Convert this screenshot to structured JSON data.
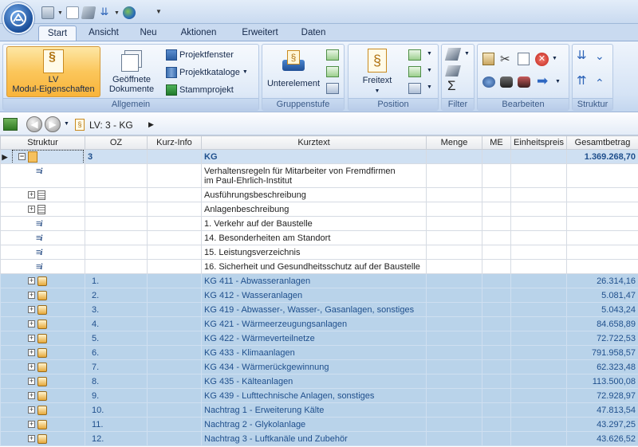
{
  "tabs": [
    "Start",
    "Ansicht",
    "Neu",
    "Aktionen",
    "Erweitert",
    "Daten"
  ],
  "ribbon": {
    "allgemein": {
      "label": "Allgemein",
      "lv_btn_line1": "LV",
      "lv_btn_line2": "Modul-Eigenschaften",
      "docs_line1": "Geöffnete",
      "docs_line2": "Dokumente",
      "projektfenster": "Projektfenster",
      "projektkataloge": "Projektkataloge",
      "stammprojekt": "Stammprojekt"
    },
    "gruppenstufe": {
      "label": "Gruppenstufe",
      "unterelement": "Unterelement"
    },
    "position": {
      "label": "Position",
      "freitext": "Freitext"
    },
    "filter": {
      "label": "Filter"
    },
    "bearbeiten": {
      "label": "Bearbeiten"
    },
    "struktur": {
      "label": "Struktur"
    }
  },
  "nav": {
    "breadcrumb": "LV: 3 - KG",
    "arrow": "▶"
  },
  "grid": {
    "columns": [
      "Struktur",
      "OZ",
      "Kurz-Info",
      "Kurztext",
      "Menge",
      "ME",
      "Einheitspreis",
      "Gesamtbetrag"
    ],
    "first_row": {
      "oz": "3",
      "kurztext": "KG",
      "gesamt": "1.369.268,70"
    },
    "text_rows": [
      {
        "kind": "i",
        "line1": "Verhaltensregeln für Mitarbeiter von Fremdfirmen",
        "line2": "im Paul-Ehrlich-Institut"
      },
      {
        "kind": "doc",
        "line1": "Ausführungsbeschreibung"
      },
      {
        "kind": "doc",
        "line1": "Anlagenbeschreibung"
      },
      {
        "kind": "i",
        "line1": "1.  Verkehr auf der Baustelle"
      },
      {
        "kind": "i",
        "line1": "14.  Besonderheiten am Standort"
      },
      {
        "kind": "i",
        "line1": "15. Leistungsverzeichnis"
      },
      {
        "kind": "i",
        "line1": "16. Sicherheit und Gesundheitsschutz auf der Baustelle"
      }
    ],
    "group_rows": [
      {
        "oz": "1.",
        "kurztext": "KG 411 - Abwasseranlagen",
        "gesamt": "26.314,16"
      },
      {
        "oz": "2.",
        "kurztext": "KG 412 - Wasseranlagen",
        "gesamt": "5.081,47"
      },
      {
        "oz": "3.",
        "kurztext": "KG 419 - Abwasser-, Wasser-, Gasanlagen, sonstiges",
        "gesamt": "5.043,24"
      },
      {
        "oz": "4.",
        "kurztext": "KG 421 - Wärmeerzeugungsanlagen",
        "gesamt": "84.658,89"
      },
      {
        "oz": "5.",
        "kurztext": "KG 422 - Wärmeverteilnetze",
        "gesamt": "72.722,53"
      },
      {
        "oz": "6.",
        "kurztext": "KG 433 - Klimaanlagen",
        "gesamt": "791.958,57"
      },
      {
        "oz": "7.",
        "kurztext": "KG 434 -  Wärmerückgewinnung",
        "gesamt": "62.323,48"
      },
      {
        "oz": "8.",
        "kurztext": "KG 435 - Kälteanlagen",
        "gesamt": "113.500,08"
      },
      {
        "oz": "9.",
        "kurztext": "KG 439 -  Lufttechnische Anlagen, sonstiges",
        "gesamt": "72.928,97"
      },
      {
        "oz": "10.",
        "kurztext": "Nachtrag 1 - Erweiterung Kälte",
        "gesamt": "47.813,54"
      },
      {
        "oz": "11.",
        "kurztext": "Nachtrag 2 - Glykolanlage",
        "gesamt": "43.297,25"
      },
      {
        "oz": "12.",
        "kurztext": "Nachtrag 3 - Luftkanäle und Zubehör",
        "gesamt": "43.626,52"
      }
    ]
  }
}
